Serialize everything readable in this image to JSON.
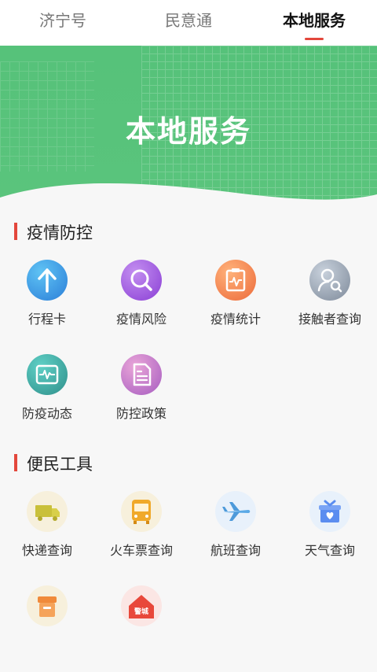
{
  "tabs": [
    {
      "label": "济宁号",
      "active": false
    },
    {
      "label": "民意通",
      "active": false
    },
    {
      "label": "本地服务",
      "active": true
    }
  ],
  "banner": {
    "title": "本地服务"
  },
  "sections": [
    {
      "title": "疫情防控",
      "items": [
        {
          "label": "行程卡",
          "icon": "arrow-up-icon"
        },
        {
          "label": "疫情风险",
          "icon": "magnifier-icon"
        },
        {
          "label": "疫情统计",
          "icon": "clipboard-chart-icon"
        },
        {
          "label": "接触者查询",
          "icon": "person-search-icon"
        },
        {
          "label": "防疫动态",
          "icon": "heartbeat-monitor-icon"
        },
        {
          "label": "防控政策",
          "icon": "document-list-icon"
        }
      ]
    },
    {
      "title": "便民工具",
      "items": [
        {
          "label": "快递查询",
          "icon": "delivery-truck-icon"
        },
        {
          "label": "火车票查询",
          "icon": "bus-icon"
        },
        {
          "label": "航班查询",
          "icon": "airplane-icon"
        },
        {
          "label": "天气查询",
          "icon": "gift-heart-icon"
        },
        {
          "label": "",
          "icon": "box-icon"
        },
        {
          "label": "",
          "icon": "house-icon",
          "badge": "警城"
        }
      ]
    }
  ],
  "colors": {
    "accent": "#e3473c",
    "banner": "#56c27a"
  }
}
